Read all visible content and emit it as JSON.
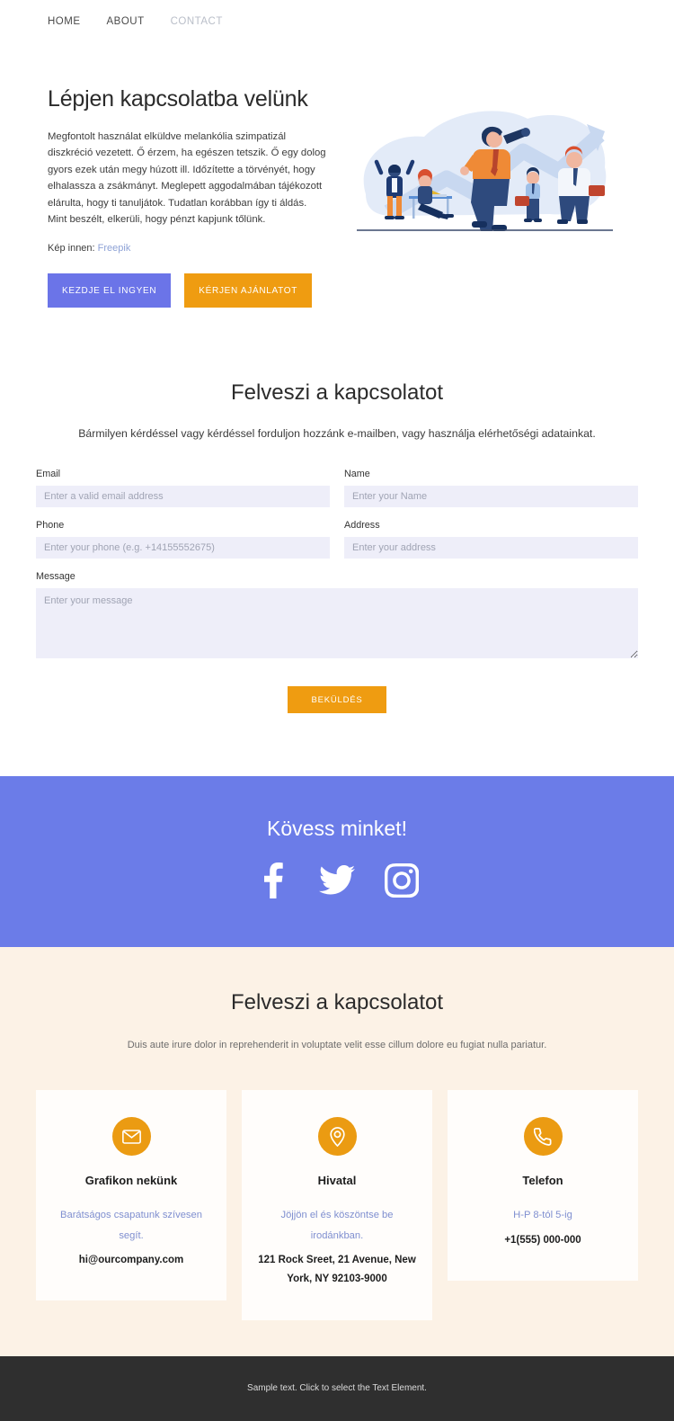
{
  "nav": {
    "items": [
      {
        "label": "HOME",
        "muted": false
      },
      {
        "label": "ABOUT",
        "muted": false
      },
      {
        "label": "CONTACT",
        "muted": true
      }
    ]
  },
  "hero": {
    "title": "Lépjen kapcsolatba velünk",
    "body": "Megfontolt használat elküldve melankólia szimpatizál diszkréció vezetett. Ő érzem, ha egészen tetszik. Ő egy dolog gyors ezek után megy húzott ill. Időzítette a törvényét, hogy elhalassza a zsákmányt. Meglepett aggodalmában tájékozott elárulta, hogy ti tanuljátok. Tudatlan korábban így ti áldás. Mint beszélt, elkerüli, hogy pénzt kapjunk tőlünk.",
    "credit_label": "Kép innen:",
    "credit_link": "Freepik",
    "primary_button": "KEZDJE EL INGYEN",
    "secondary_button": "KÉRJEN AJÁNLATOT",
    "illustration": "business-team-telescope-growth-illustration"
  },
  "form": {
    "title": "Felveszi a kapcsolatot",
    "subtitle": "Bármilyen kérdéssel vagy kérdéssel forduljon hozzánk e-mailben, vagy használja elérhetőségi adatainkat.",
    "fields": {
      "email": {
        "label": "Email",
        "placeholder": "Enter a valid email address",
        "value": ""
      },
      "name": {
        "label": "Name",
        "placeholder": "Enter your Name",
        "value": ""
      },
      "phone": {
        "label": "Phone",
        "placeholder": "Enter your phone (e.g. +14155552675)",
        "value": ""
      },
      "address": {
        "label": "Address",
        "placeholder": "Enter your address",
        "value": ""
      },
      "message": {
        "label": "Message",
        "placeholder": "Enter your message",
        "value": ""
      }
    },
    "submit_label": "BEKÜLDÉS"
  },
  "social": {
    "title": "Kövess minket!",
    "icons": [
      {
        "name": "facebook-icon"
      },
      {
        "name": "twitter-icon"
      },
      {
        "name": "instagram-icon"
      }
    ]
  },
  "contact": {
    "title": "Felveszi a kapcsolatot",
    "subtitle": "Duis aute irure dolor in reprehenderit in voluptate velit esse cillum dolore eu fugiat nulla pariatur.",
    "cards": [
      {
        "icon": "envelope-icon",
        "title": "Grafikon nekünk",
        "note": "Barátságos csapatunk szívesen segít.",
        "value": "hi@ourcompany.com"
      },
      {
        "icon": "map-pin-icon",
        "title": "Hivatal",
        "note": "Jöjjön el és köszöntse be irodánkban.",
        "value": "121 Rock Sreet, 21 Avenue, New York, NY 92103-9000"
      },
      {
        "icon": "phone-icon",
        "title": "Telefon",
        "note": "H-P 8-tól 5-ig",
        "value": "+1(555) 000-000"
      }
    ]
  },
  "footer": {
    "text": "Sample text. Click to select the Text Element."
  },
  "colors": {
    "accent_purple": "#6b7ce8",
    "accent_orange": "#ef9c11",
    "cream": "#fcf2e6",
    "footer_dark": "#2f2f2f",
    "input_bg": "#eeeef9",
    "link_blue": "#8ea2d6",
    "note_blue": "#7f8fd0"
  }
}
